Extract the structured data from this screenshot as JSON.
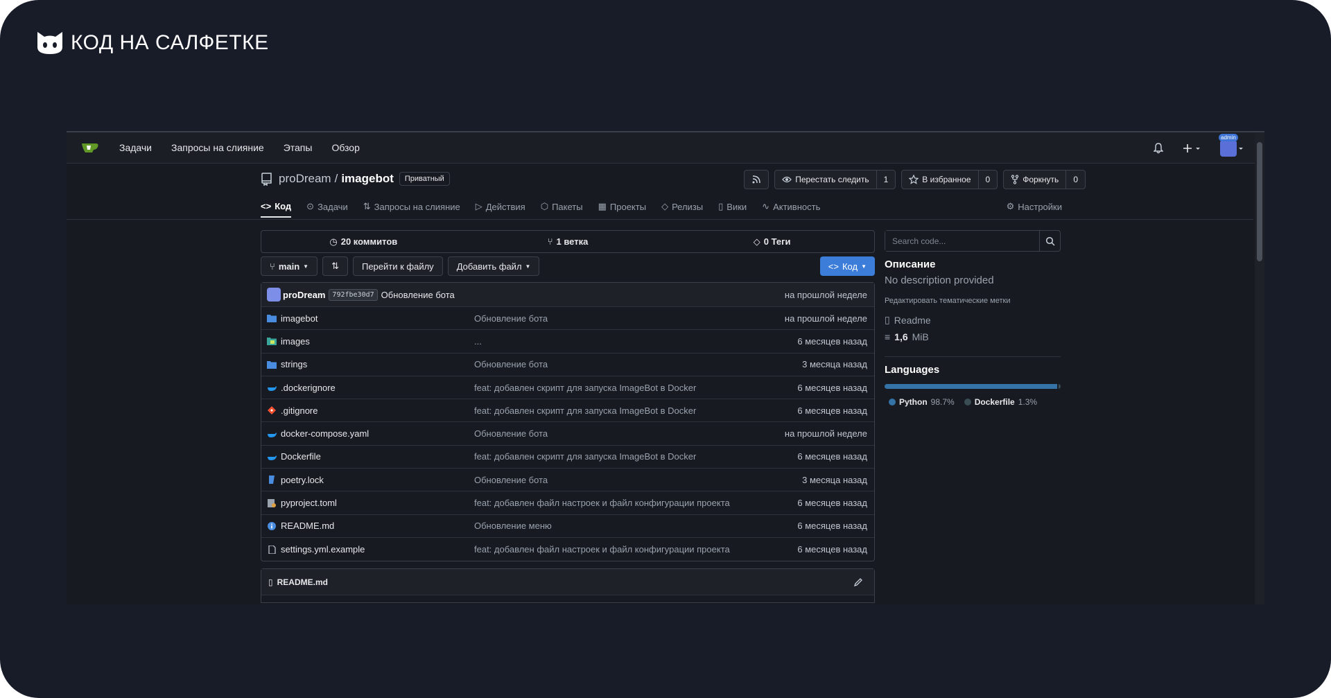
{
  "brand": {
    "text": "КОД НА САЛФЕТКЕ"
  },
  "nav": {
    "items": [
      "Задачи",
      "Запросы на слияние",
      "Этапы",
      "Обзор"
    ],
    "avatar_badge": "admin"
  },
  "repo": {
    "owner": "proDream",
    "separator": "/",
    "name": "imagebot",
    "visibility": "Приватный",
    "watch_label": "Перестать следить",
    "watch_count": "1",
    "star_label": "В избранное",
    "star_count": "0",
    "fork_label": "Форкнуть",
    "fork_count": "0"
  },
  "tabs": [
    {
      "label": "Код",
      "icon": "code-icon"
    },
    {
      "label": "Задачи",
      "icon": "issue-icon"
    },
    {
      "label": "Запросы на слияние",
      "icon": "pull-request-icon"
    },
    {
      "label": "Действия",
      "icon": "play-icon"
    },
    {
      "label": "Пакеты",
      "icon": "package-icon"
    },
    {
      "label": "Проекты",
      "icon": "project-icon"
    },
    {
      "label": "Релизы",
      "icon": "tag-icon"
    },
    {
      "label": "Вики",
      "icon": "book-icon"
    },
    {
      "label": "Активность",
      "icon": "pulse-icon"
    },
    {
      "label": "Настройки",
      "icon": "tools-icon"
    }
  ],
  "stats": {
    "commits": "20 коммитов",
    "branches": "1 ветка",
    "tags": "0 Теги"
  },
  "toolbar": {
    "branch": "main",
    "goto_file": "Перейти к файлу",
    "add_file": "Добавить файл",
    "code": "Код"
  },
  "last_commit": {
    "author": "proDream",
    "sha": "792fbe30d7",
    "message": "Обновление бота",
    "time": "на прошлой неделе"
  },
  "files": [
    {
      "name": "imagebot",
      "type": "folder",
      "message": "Обновление бота",
      "time": "на прошлой неделе"
    },
    {
      "name": "images",
      "type": "folder-images",
      "message": "...",
      "time": "6 месяцев назад"
    },
    {
      "name": "strings",
      "type": "folder",
      "message": "Обновление бота",
      "time": "3 месяца назад"
    },
    {
      "name": ".dockerignore",
      "type": "docker",
      "message": "feat: добавлен скрипт для запуска ImageBot в Docker",
      "time": "6 месяцев назад"
    },
    {
      "name": ".gitignore",
      "type": "git",
      "message": "feat: добавлен скрипт для запуска ImageBot в Docker",
      "time": "6 месяцев назад"
    },
    {
      "name": "docker-compose.yaml",
      "type": "docker",
      "message": "Обновление бота",
      "time": "на прошлой неделе"
    },
    {
      "name": "Dockerfile",
      "type": "docker",
      "message": "feat: добавлен скрипт для запуска ImageBot в Docker",
      "time": "6 месяцев назад"
    },
    {
      "name": "poetry.lock",
      "type": "lock",
      "message": "Обновление бота",
      "time": "3 месяца назад"
    },
    {
      "name": "pyproject.toml",
      "type": "toml",
      "message": "feat: добавлен файл настроек и файл конфигурации проекта",
      "time": "6 месяцев назад"
    },
    {
      "name": "README.md",
      "type": "info",
      "message": "Обновление меню",
      "time": "6 месяцев назад"
    },
    {
      "name": "settings.yml.example",
      "type": "file",
      "message": "feat: добавлен файл настроек и файл конфигурации проекта",
      "time": "6 месяцев назад"
    }
  ],
  "readme": {
    "title": "README.md"
  },
  "sidebar": {
    "search_placeholder": "Search code...",
    "description_title": "Описание",
    "description": "No description provided",
    "edit_topics": "Редактировать тематические метки",
    "readme_link": "Readme",
    "size_value": "1,6",
    "size_unit": "MiB",
    "languages_title": "Languages",
    "languages": [
      {
        "name": "Python",
        "percent": "98.7%",
        "value": 98.7,
        "color": "#3572A5"
      },
      {
        "name": "Dockerfile",
        "percent": "1.3%",
        "value": 1.3,
        "color": "#384d54"
      }
    ]
  },
  "colors": {
    "accent": "#3b7dd8",
    "background": "#171a21",
    "frame": "#181b28"
  }
}
